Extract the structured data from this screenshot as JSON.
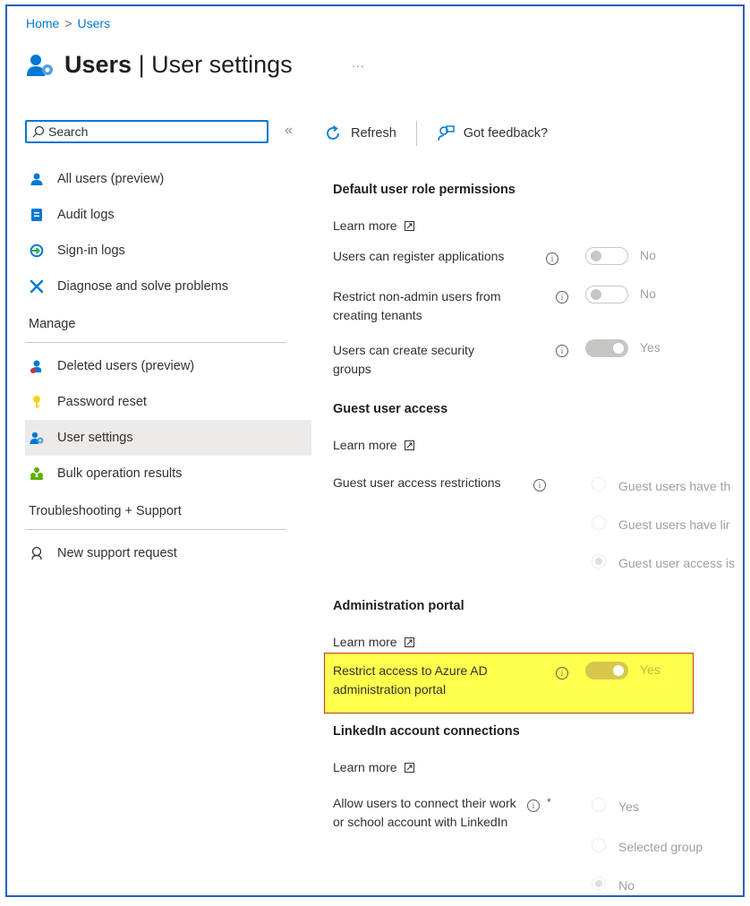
{
  "breadcrumb": {
    "home": "Home",
    "separator": ">",
    "current": "Users"
  },
  "header": {
    "title_bold": "Users",
    "title_rest": " | User settings",
    "ellipsis": "..."
  },
  "sidebar": {
    "search_placeholder": "Search",
    "collapse": "«",
    "items_top": [
      {
        "label": "All users (preview)",
        "icon": "user-icon"
      },
      {
        "label": "Audit logs",
        "icon": "audit-log-icon"
      },
      {
        "label": "Sign-in logs",
        "icon": "sign-in-icon"
      },
      {
        "label": "Diagnose and solve problems",
        "icon": "wrench-icon"
      }
    ],
    "section_manage": "Manage",
    "items_manage": [
      {
        "label": "Deleted users (preview)",
        "icon": "deleted-user-icon"
      },
      {
        "label": "Password reset",
        "icon": "key-icon"
      },
      {
        "label": "User settings",
        "icon": "user-settings-icon",
        "active": true
      },
      {
        "label": "Bulk operation results",
        "icon": "group-icon"
      }
    ],
    "section_support": "Troubleshooting + Support",
    "items_support": [
      {
        "label": "New support request",
        "icon": "support-icon"
      }
    ]
  },
  "toolbar": {
    "refresh": "Refresh",
    "feedback": "Got feedback?"
  },
  "sections": {
    "default_perms": {
      "heading": "Default user role permissions",
      "learn_more": "Learn more",
      "register_apps": {
        "label": "Users can register applications",
        "value": "No"
      },
      "restrict_tenants": {
        "label": "Restrict non-admin users from creating tenants",
        "value": "No"
      },
      "security_groups": {
        "label": "Users can create security groups",
        "value": "Yes"
      }
    },
    "guest": {
      "heading": "Guest user access",
      "learn_more": "Learn more",
      "label": "Guest user access restrictions",
      "options": [
        "Guest users have th",
        "Guest users have lir",
        "Guest user access is"
      ]
    },
    "admin_portal": {
      "heading": "Administration portal",
      "learn_more": "Learn more",
      "label": "Restrict access to Azure AD administration portal",
      "value": "Yes"
    },
    "linkedin": {
      "heading": "LinkedIn account connections",
      "learn_more": "Learn more",
      "label": "Allow users to connect their work or school account with LinkedIn",
      "required": "*",
      "options": [
        "Yes",
        "Selected group",
        "No"
      ]
    }
  },
  "info_glyph": "i",
  "colors": {
    "accent": "#0078d4",
    "highlight": "#ffff4d",
    "highlight_border": "#c0392b"
  }
}
